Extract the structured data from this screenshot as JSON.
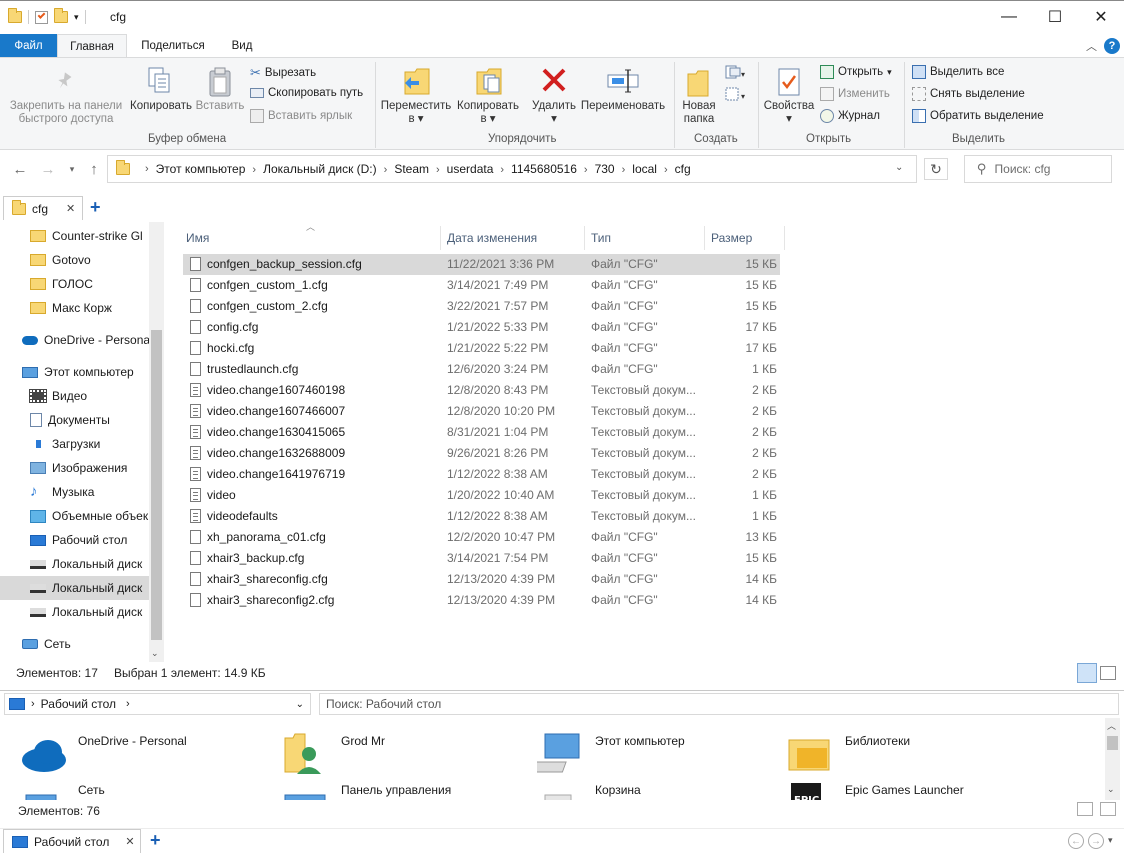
{
  "window": {
    "title": "cfg",
    "minimize_glyph": "—",
    "maximize_glyph": "☐",
    "close_glyph": "✕"
  },
  "ribbon_tabs": [
    "Файл",
    "Главная",
    "Поделиться",
    "Вид"
  ],
  "ribbon": {
    "clipboard": {
      "title": "Буфер обмена",
      "pin_label_1": "Закрепить на панели",
      "pin_label_2": "быстрого доступа",
      "copy": "Копировать",
      "paste": "Вставить",
      "cut": "Вырезать",
      "copy_path": "Скопировать путь",
      "paste_shortcut": "Вставить ярлык"
    },
    "organize": {
      "title": "Упорядочить",
      "move_1": "Переместить",
      "move_2": "в",
      "copy_1": "Копировать",
      "copy_2": "в",
      "delete": "Удалить",
      "rename": "Переименовать"
    },
    "create": {
      "title": "Создать",
      "new_folder_1": "Новая",
      "new_folder_2": "папка"
    },
    "open": {
      "title": "Открыть",
      "properties": "Свойства",
      "open": "Открыть",
      "edit": "Изменить",
      "history": "Журнал"
    },
    "select": {
      "title": "Выделить",
      "select_all": "Выделить все",
      "select_none": "Снять выделение",
      "invert": "Обратить выделение"
    }
  },
  "address": {
    "crumbs": [
      "Этот компьютер",
      "Локальный диск (D:)",
      "Steam",
      "userdata",
      "1145680516",
      "730",
      "local",
      "cfg"
    ],
    "search_placeholder": "Поиск: cfg"
  },
  "doc_tab": {
    "label": "cfg",
    "close": "✕",
    "add": "+"
  },
  "sidebar": [
    {
      "label": "Counter-strike  Gl",
      "icon": "folder-icon"
    },
    {
      "label": "Gotovo",
      "icon": "folder-icon"
    },
    {
      "label": "ГОЛОС",
      "icon": "folder-icon"
    },
    {
      "label": "Макс Корж",
      "icon": "folder-icon"
    },
    {
      "label": "OneDrive - Persona",
      "icon": "onedrive-icon"
    },
    {
      "label": "Этот компьютер",
      "icon": "computer-icon"
    },
    {
      "label": "Видео",
      "icon": "video-icon"
    },
    {
      "label": "Документы",
      "icon": "documents-icon"
    },
    {
      "label": "Загрузки",
      "icon": "downloads-icon"
    },
    {
      "label": "Изображения",
      "icon": "pictures-icon"
    },
    {
      "label": "Музыка",
      "icon": "music-icon"
    },
    {
      "label": "Объемные объек",
      "icon": "3d-objects-icon"
    },
    {
      "label": "Рабочий стол",
      "icon": "desktop-icon"
    },
    {
      "label": "Локальный диск",
      "icon": "drive-c-icon"
    },
    {
      "label": "Локальный диск",
      "icon": "drive-icon"
    },
    {
      "label": "Локальный диск",
      "icon": "drive-icon"
    },
    {
      "label": "Сеть",
      "icon": "network-icon"
    }
  ],
  "columns": {
    "name": "Имя",
    "date": "Дата изменения",
    "type": "Тип",
    "size": "Размер"
  },
  "files": [
    {
      "name": "confgen_backup_session.cfg",
      "date": "11/22/2021 3:36 PM",
      "type": "Файл \"CFG\"",
      "size": "15 КБ",
      "kind": "blank"
    },
    {
      "name": "confgen_custom_1.cfg",
      "date": "3/14/2021 7:49 PM",
      "type": "Файл \"CFG\"",
      "size": "15 КБ",
      "kind": "blank"
    },
    {
      "name": "confgen_custom_2.cfg",
      "date": "3/22/2021 7:57 PM",
      "type": "Файл \"CFG\"",
      "size": "15 КБ",
      "kind": "blank"
    },
    {
      "name": "config.cfg",
      "date": "1/21/2022 5:33 PM",
      "type": "Файл \"CFG\"",
      "size": "17 КБ",
      "kind": "blank"
    },
    {
      "name": "hocki.cfg",
      "date": "1/21/2022 5:22 PM",
      "type": "Файл \"CFG\"",
      "size": "17 КБ",
      "kind": "blank"
    },
    {
      "name": "trustedlaunch.cfg",
      "date": "12/6/2020 3:24 PM",
      "type": "Файл \"CFG\"",
      "size": "1 КБ",
      "kind": "blank"
    },
    {
      "name": "video.change1607460198",
      "date": "12/8/2020 8:43 PM",
      "type": "Текстовый докум...",
      "size": "2 КБ",
      "kind": "txt"
    },
    {
      "name": "video.change1607466007",
      "date": "12/8/2020 10:20 PM",
      "type": "Текстовый докум...",
      "size": "2 КБ",
      "kind": "txt"
    },
    {
      "name": "video.change1630415065",
      "date": "8/31/2021 1:04 PM",
      "type": "Текстовый докум...",
      "size": "2 КБ",
      "kind": "txt"
    },
    {
      "name": "video.change1632688009",
      "date": "9/26/2021 8:26 PM",
      "type": "Текстовый докум...",
      "size": "2 КБ",
      "kind": "txt"
    },
    {
      "name": "video.change1641976719",
      "date": "1/12/2022 8:38 AM",
      "type": "Текстовый докум...",
      "size": "2 КБ",
      "kind": "txt"
    },
    {
      "name": "video",
      "date": "1/20/2022 10:40 AM",
      "type": "Текстовый докум...",
      "size": "1 КБ",
      "kind": "txt"
    },
    {
      "name": "videodefaults",
      "date": "1/12/2022 8:38 AM",
      "type": "Текстовый докум...",
      "size": "1 КБ",
      "kind": "txt"
    },
    {
      "name": "xh_panorama_c01.cfg",
      "date": "12/2/2020 10:47 PM",
      "type": "Файл \"CFG\"",
      "size": "13 КБ",
      "kind": "blank"
    },
    {
      "name": "xhair3_backup.cfg",
      "date": "3/14/2021 7:54 PM",
      "type": "Файл \"CFG\"",
      "size": "15 КБ",
      "kind": "blank"
    },
    {
      "name": "xhair3_shareconfig.cfg",
      "date": "12/13/2020 4:39 PM",
      "type": "Файл \"CFG\"",
      "size": "14 КБ",
      "kind": "blank"
    },
    {
      "name": "xhair3_shareconfig2.cfg",
      "date": "12/13/2020 4:39 PM",
      "type": "Файл \"CFG\"",
      "size": "14 КБ",
      "kind": "blank"
    }
  ],
  "status": {
    "count": "Элементов: 17",
    "selection": "Выбран 1 элемент: 14.9 КБ"
  },
  "pane2": {
    "address": "Рабочий стол",
    "search_placeholder": "Поиск: Рабочий стол",
    "tiles": [
      {
        "label": "OneDrive - Personal",
        "icon": "onedrive-icon"
      },
      {
        "label": "Grod Mr",
        "icon": "user-folder-icon"
      },
      {
        "label": "Этот компьютер",
        "icon": "computer-icon"
      },
      {
        "label": "Библиотеки",
        "icon": "libraries-icon"
      },
      {
        "label": "Сеть",
        "icon": "network-icon"
      },
      {
        "label": "Панель управления",
        "icon": "control-panel-icon"
      },
      {
        "label": "Корзина",
        "icon": "recycle-bin-icon"
      },
      {
        "label": "Epic Games Launcher",
        "icon": "epic-games-icon"
      }
    ],
    "status": "Элементов: 76",
    "tab_label": "Рабочий стол"
  },
  "colors": {
    "accent": "#1979ca",
    "selection": "#d9d9d9",
    "folder": "#f8d775",
    "header_text": "#4c607a"
  }
}
